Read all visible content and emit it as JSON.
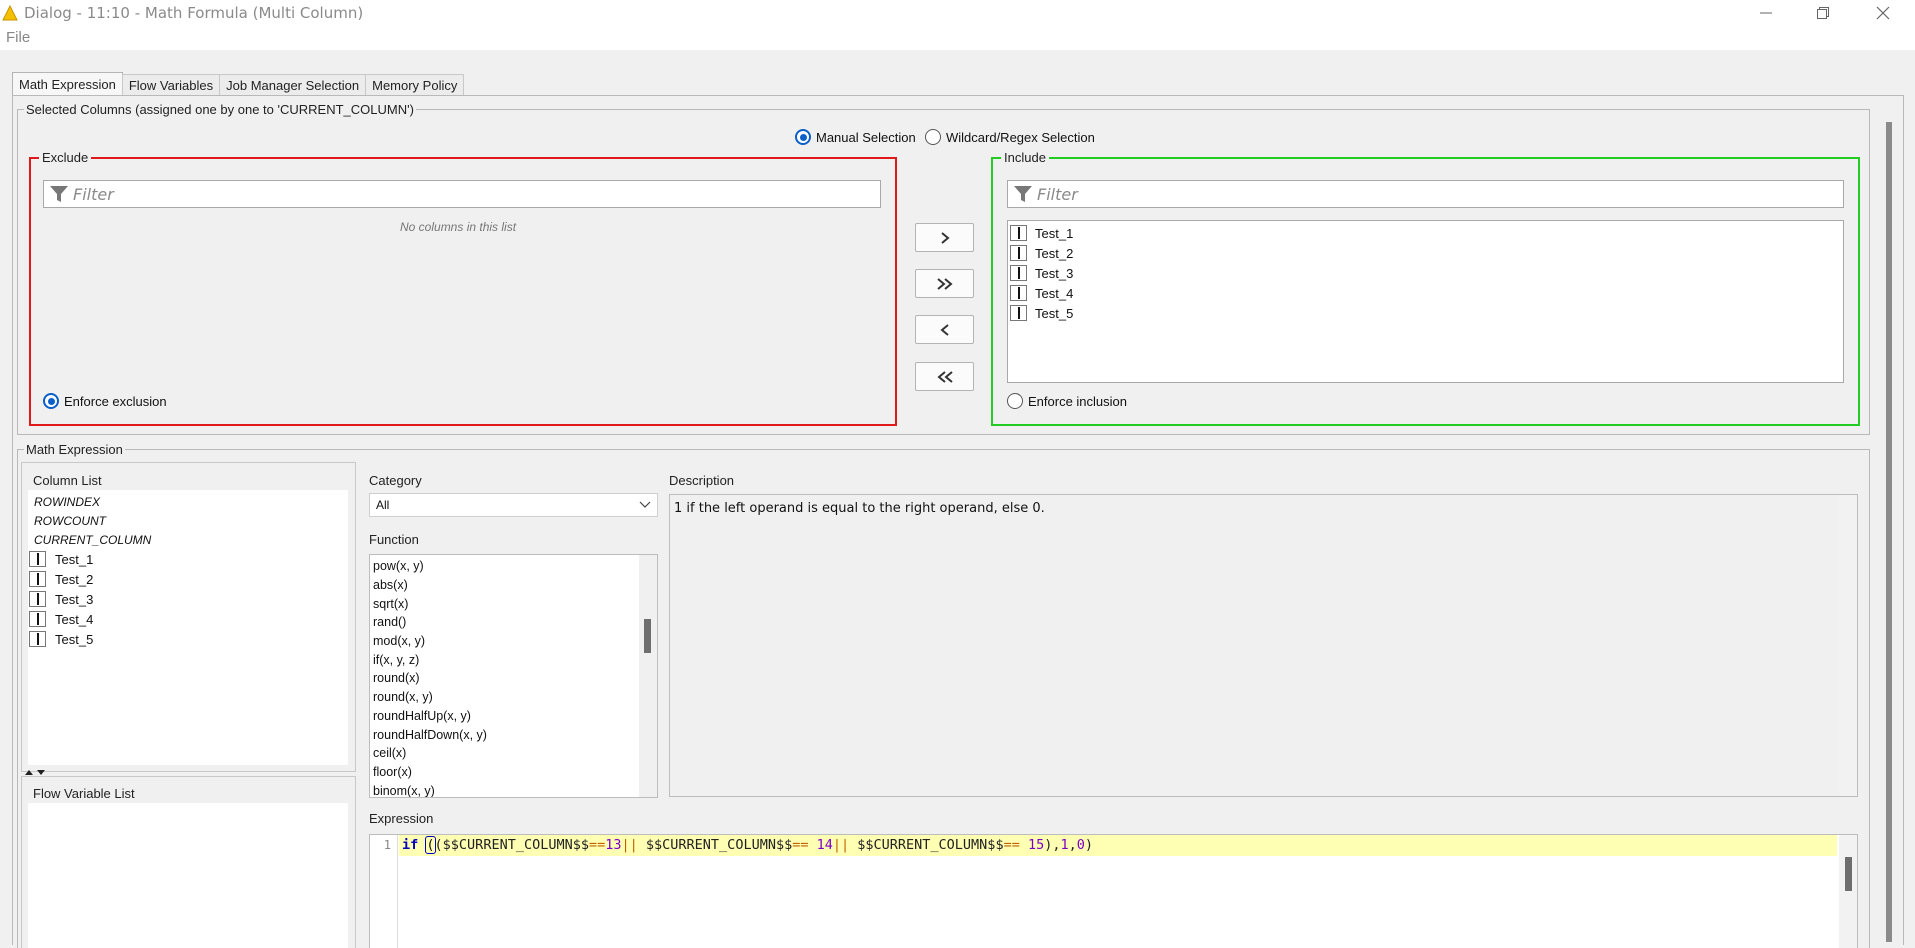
{
  "window": {
    "title": "Dialog - 11:10 - Math Formula (Multi Column)",
    "menu": [
      "File"
    ]
  },
  "tabs": [
    "Math Expression",
    "Flow Variables",
    "Job Manager Selection",
    "Memory Policy"
  ],
  "selected_columns": {
    "group_title": "Selected Columns (assigned one by one to 'CURRENT_COLUMN')",
    "mode_manual": "Manual Selection",
    "mode_wildcard": "Wildcard/Regex Selection",
    "exclude": {
      "title": "Exclude",
      "filter_placeholder": "Filter",
      "empty_text": "No columns in this list",
      "enforce_label": "Enforce exclusion"
    },
    "include": {
      "title": "Include",
      "filter_placeholder": "Filter",
      "columns": [
        "Test_1",
        "Test_2",
        "Test_3",
        "Test_4",
        "Test_5"
      ],
      "enforce_label": "Enforce inclusion"
    },
    "buttons": [
      ">",
      "»",
      "<",
      "«"
    ]
  },
  "math_expression": {
    "group_title": "Math Expression",
    "column_list_title": "Column List",
    "special_columns": [
      "ROWINDEX",
      "ROWCOUNT",
      "CURRENT_COLUMN"
    ],
    "columns": [
      "Test_1",
      "Test_2",
      "Test_3",
      "Test_4",
      "Test_5"
    ],
    "flow_variable_title": "Flow Variable List",
    "category_label": "Category",
    "category_value": "All",
    "function_label": "Function",
    "functions": [
      "pow(x, y)",
      "abs(x)",
      "sqrt(x)",
      "rand()",
      "mod(x, y)",
      "if(x, y, z)",
      "round(x)",
      "round(x, y)",
      "roundHalfUp(x, y)",
      "roundHalfDown(x, y)",
      "ceil(x)",
      "floor(x)",
      "binom(x, y)"
    ],
    "description_label": "Description",
    "description_text": "1 if the left operand is equal to the right operand, else 0.",
    "expression_label": "Expression",
    "line_number": "1",
    "expression": {
      "kw": "if",
      "paren_open": "(",
      "p1": "($$CURRENT_COLUMN$$",
      "op1": "==",
      "n1": "13",
      "or1": "||",
      "p2": " $$CURRENT_COLUMN$$",
      "op2": "==",
      "n2": " 14",
      "or2": "||",
      "p3": " $$CURRENT_COLUMN$$",
      "op3": "==",
      "n3": " 15",
      "tail1": "),",
      "n4": "1",
      "comma": ",",
      "n5": "0",
      "tail2": ")"
    }
  },
  "colors": {
    "exclude_border": "#e01a1a",
    "include_border": "#22cc22",
    "radio_accent": "#0a5fc8",
    "expression_highlight": "#ffffb4"
  }
}
